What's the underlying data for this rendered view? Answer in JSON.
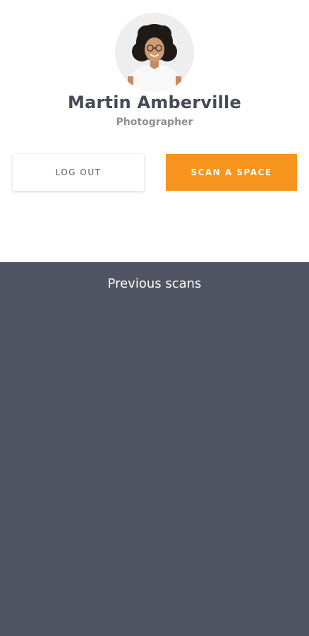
{
  "profile": {
    "name": "Martin Amberville",
    "role": "Photographer",
    "avatar_icon": "user-avatar-photo"
  },
  "actions": {
    "logout_label": "LOG OUT",
    "scan_label": "SCAN A SPACE"
  },
  "scans": {
    "title": "Previous scans"
  },
  "colors": {
    "accent": "#f7941d",
    "section_bg": "#515462",
    "name_text": "#464a57",
    "role_text": "#8c8e96"
  }
}
